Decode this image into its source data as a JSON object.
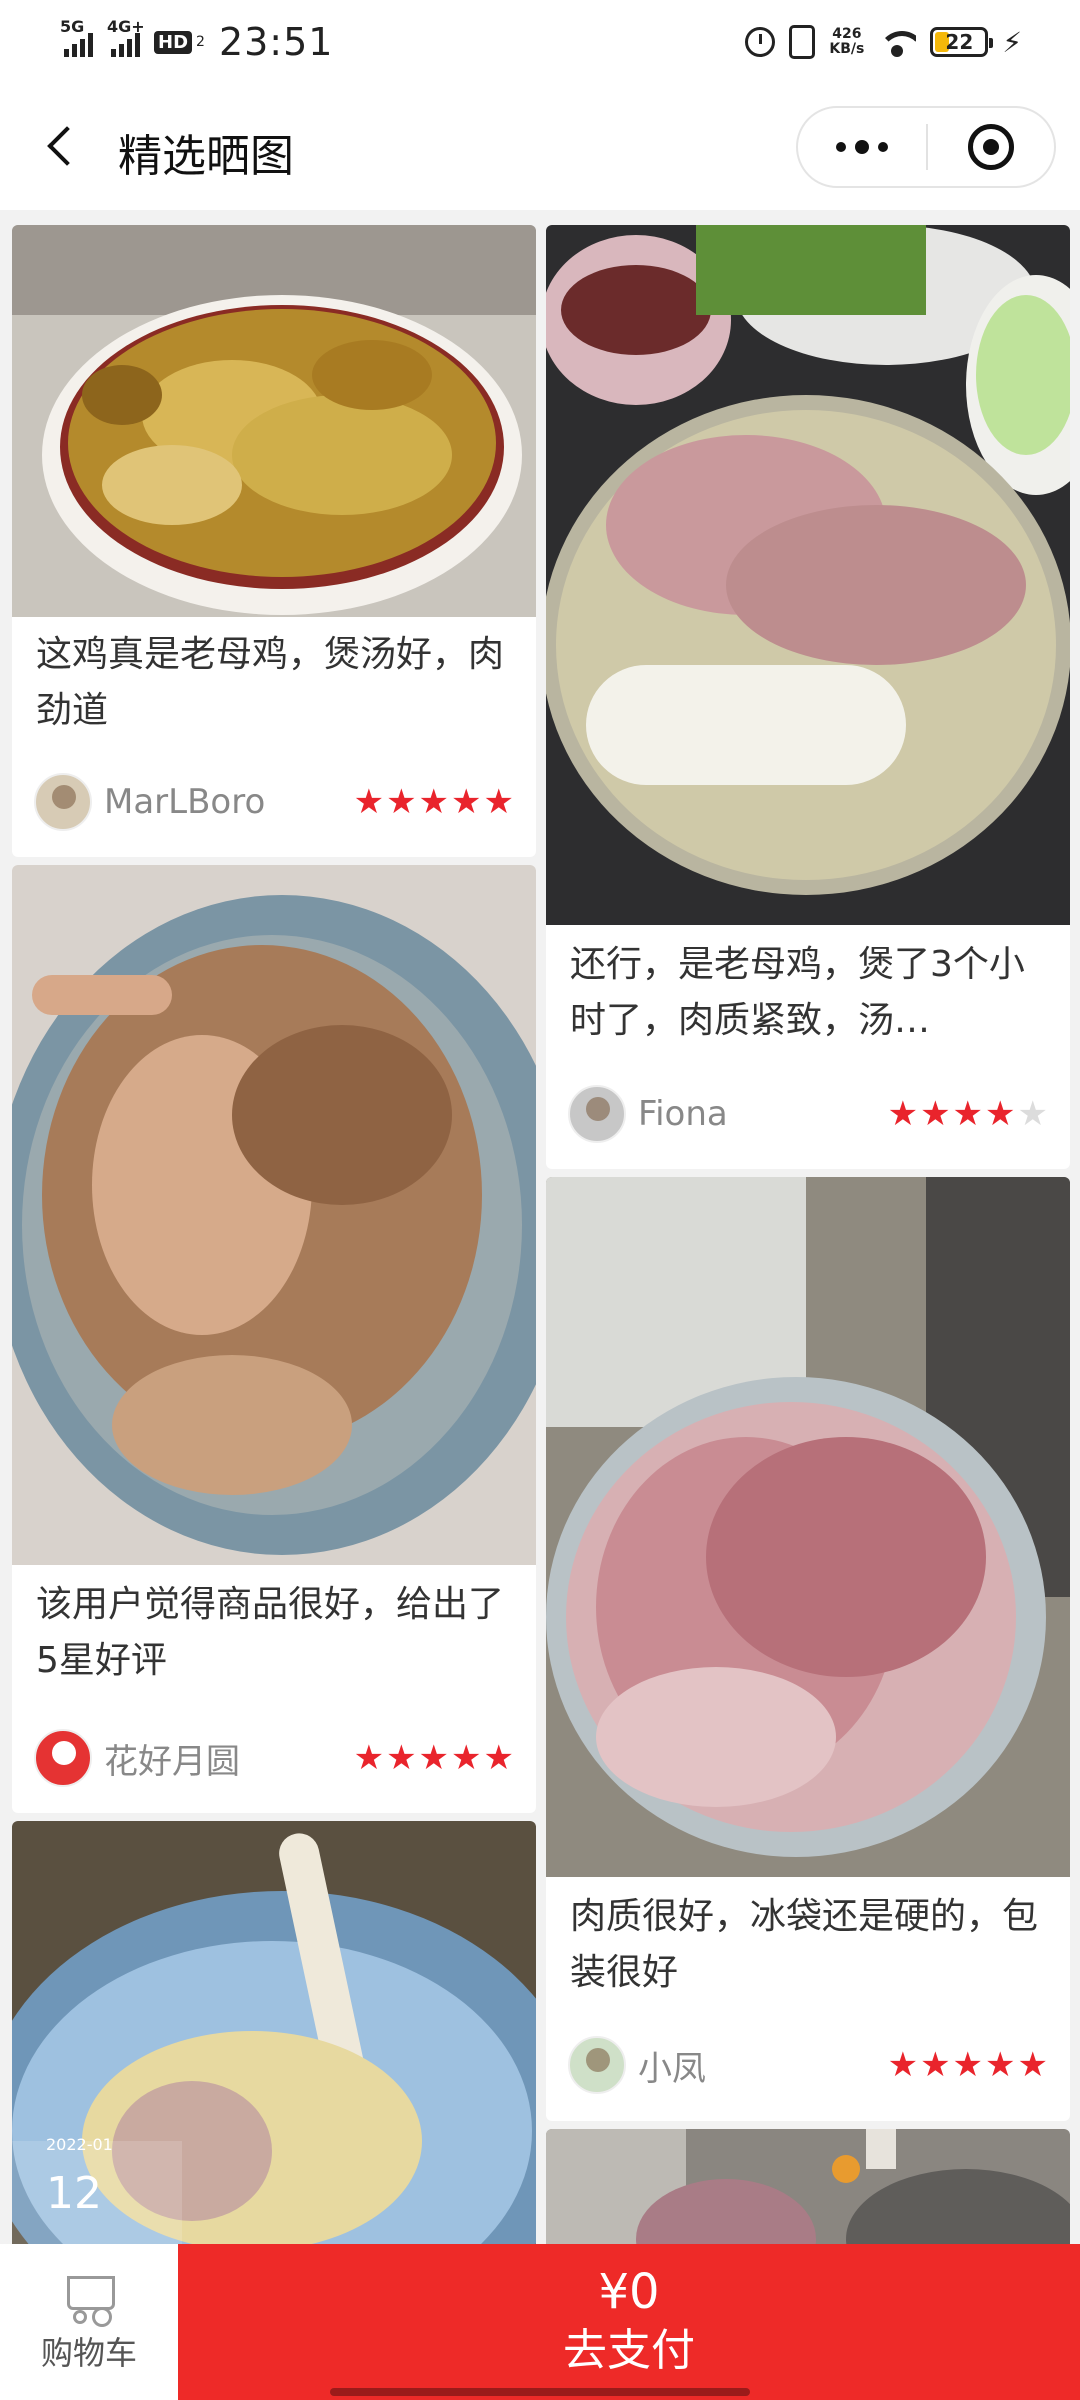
{
  "status_bar": {
    "sim1": "5G",
    "sim2": "4G+",
    "hd_badge": "HD",
    "hd_sub": "2",
    "time": "23:51",
    "net_speed_value": "426",
    "net_speed_unit": "KB/s",
    "battery": "22"
  },
  "nav": {
    "title": "精选晒图"
  },
  "reviews": [
    {
      "text": "这鸡真是老母鸡，煲汤好，肉劲道",
      "user": "MarLBoro",
      "rating": 5
    },
    {
      "text": "还行，是老母鸡，煲了3个小时了，肉质紧致，汤…",
      "user": "Fiona",
      "rating": 4
    },
    {
      "text": "该用户觉得商品很好，给出了5星好评",
      "user": "花好月圆",
      "rating": 5
    },
    {
      "text": "肉质很好，冰袋还是硬的，包装很好",
      "user": "小凤",
      "rating": 5
    }
  ],
  "photo_overlay": {
    "date": "2022-01",
    "day": "12"
  },
  "bottom": {
    "cart_label": "购物车",
    "price": "¥0",
    "pay_label": "去支付"
  },
  "colors": {
    "accent": "#ee2a28",
    "star": "#e9242c"
  }
}
